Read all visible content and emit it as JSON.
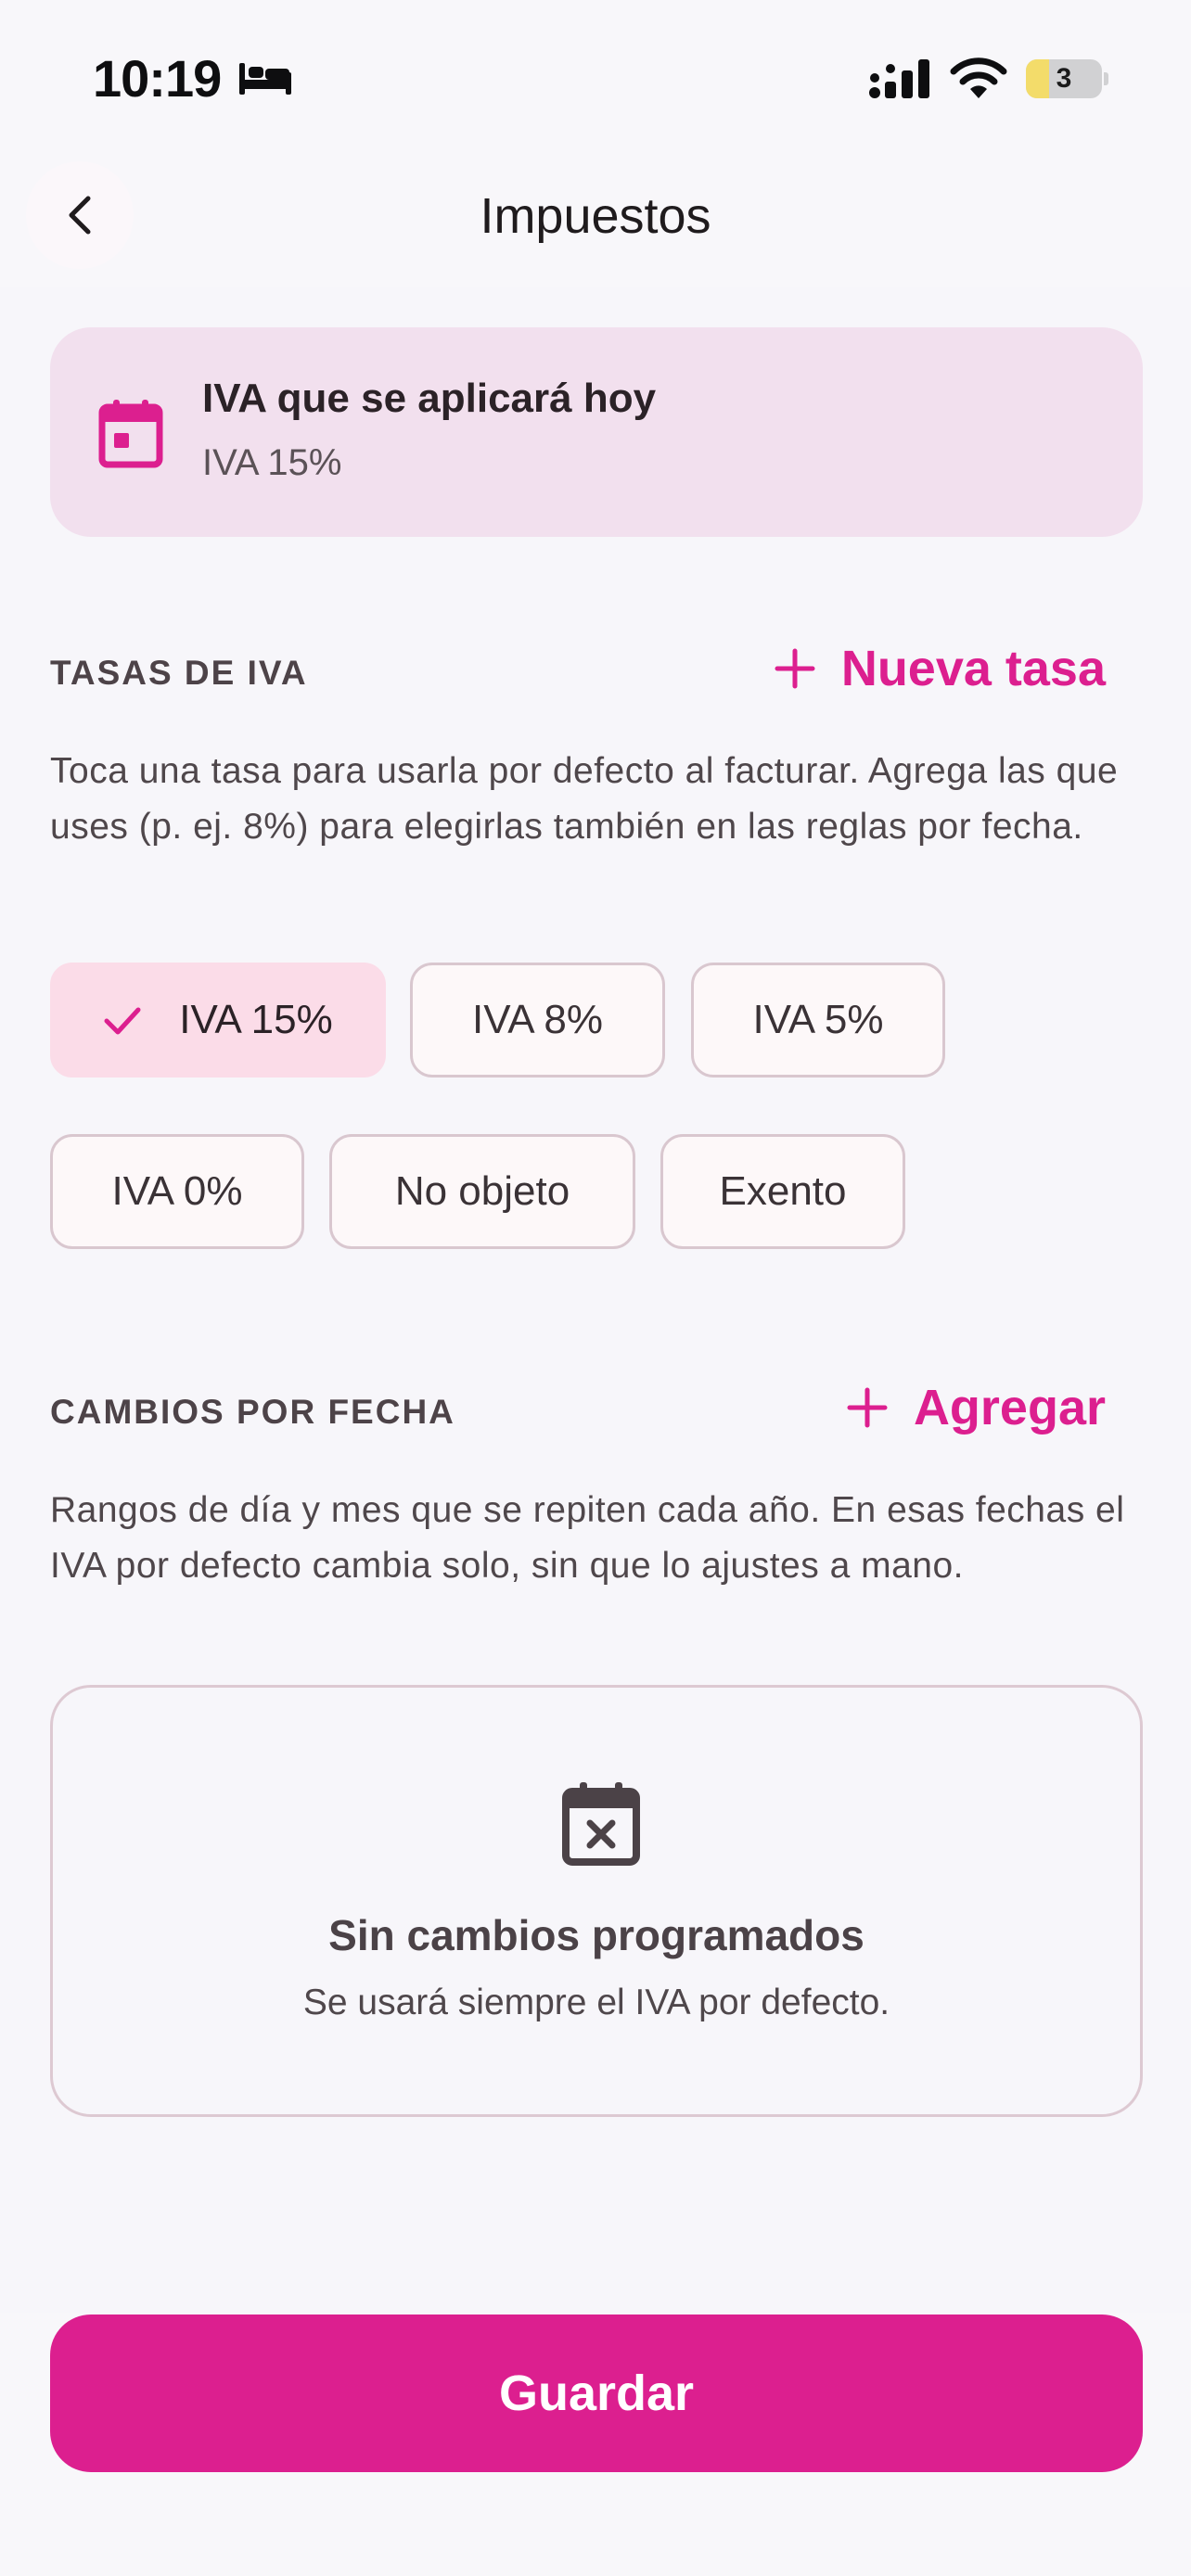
{
  "status_bar": {
    "time": "10:19",
    "battery_level": "3",
    "battery_fraction": 0.3,
    "icons": [
      "bed-icon",
      "signal-icon",
      "wifi-icon",
      "battery-icon"
    ]
  },
  "header": {
    "title": "Impuestos",
    "back_icon": "chevron-left-icon"
  },
  "today_card": {
    "icon": "calendar-icon",
    "title": "IVA que se aplicará hoy",
    "value": "IVA 15%"
  },
  "rates_section": {
    "title": "TASAS DE IVA",
    "action_label": "Nueva tasa",
    "description": "Toca una tasa para usarla por defecto al facturar. Agrega las que uses (p. ej. 8%) para elegirlas también en las reglas por fecha.",
    "chips": [
      {
        "label": "IVA 15%",
        "selected": true
      },
      {
        "label": "IVA 8%",
        "selected": false
      },
      {
        "label": "IVA 5%",
        "selected": false
      },
      {
        "label": "IVA 0%",
        "selected": false
      },
      {
        "label": "No objeto",
        "selected": false
      },
      {
        "label": "Exento",
        "selected": false
      }
    ]
  },
  "changes_section": {
    "title": "CAMBIOS POR FECHA",
    "action_label": "Agregar",
    "description": "Rangos de día y mes que se repiten cada año. En esas fechas el IVA por defecto cambia solo, sin que lo ajustes a mano.",
    "empty_icon": "calendar-x-icon",
    "empty_title": "Sin cambios programados",
    "empty_subtitle": "Se usará siempre el IVA por defecto."
  },
  "footer": {
    "save_label": "Guardar"
  },
  "colors": {
    "accent": "#dc1f8f",
    "card_bg": "#f2e0ee",
    "chip_selected_bg": "#fbdce8",
    "background": "#f7f6fa"
  }
}
